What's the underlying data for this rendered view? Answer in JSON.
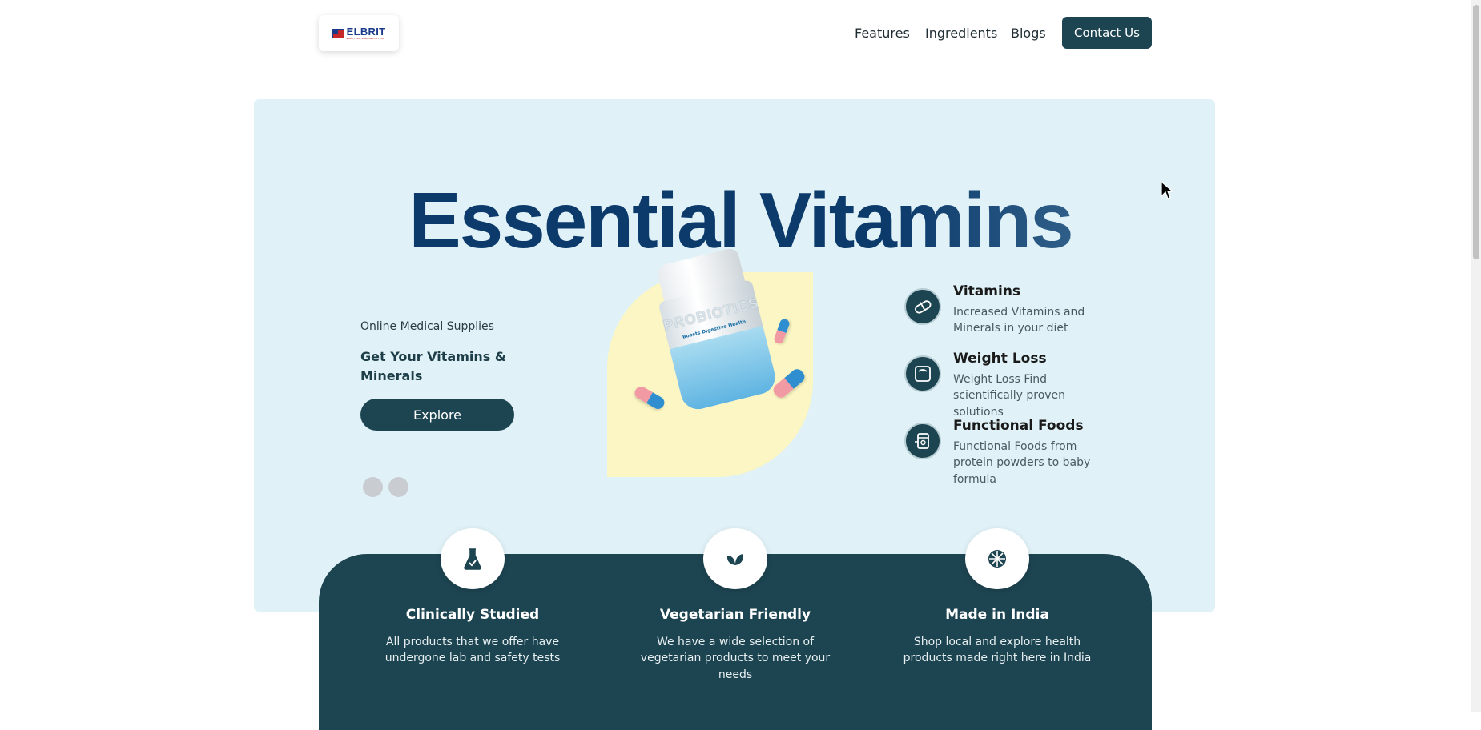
{
  "header": {
    "logo_text": "ELBRIT",
    "logo_subtext": "ELBRIT LIFE SCIENCES PVT LTD",
    "nav": [
      "Features",
      "Ingredients",
      "Blogs"
    ],
    "contact_label": "Contact Us"
  },
  "hero": {
    "title": "Essential Vitamins",
    "sub_label": "Online Medical Supplies",
    "sub_heading": "Get Your Vitamins & Minerals",
    "explore_label": "Explore",
    "carousel_dots": 2,
    "product": {
      "bottle_label": "PROBIOTICS",
      "bottle_tagline": "Boosts Digestive Health"
    }
  },
  "features": [
    {
      "icon": "pill-icon",
      "title": "Vitamins",
      "desc": "Increased Vitamins and Minerals in your diet"
    },
    {
      "icon": "scale-icon",
      "title": "Weight Loss",
      "desc": "Weight Loss Find scientifically proven solutions"
    },
    {
      "icon": "food-jar-icon",
      "title": "Functional Foods",
      "desc": "Functional Foods from protein powders to baby formula"
    }
  ],
  "highlights": [
    {
      "icon": "flask-icon",
      "title": "Clinically Studied",
      "desc": "All products that we offer have undergone lab and safety tests"
    },
    {
      "icon": "leaf-icon",
      "title": "Vegetarian Friendly",
      "desc": "We have a wide selection of vegetarian products to meet your needs"
    },
    {
      "icon": "wheel-icon",
      "title": "Made in India",
      "desc": "Shop local and explore health products made right here in India"
    }
  ],
  "colors": {
    "primary": "#1d4451",
    "hero_bg": "#e0f2f7",
    "title_blue": "#0b3a6b",
    "product_bg": "#fbf6c3"
  }
}
